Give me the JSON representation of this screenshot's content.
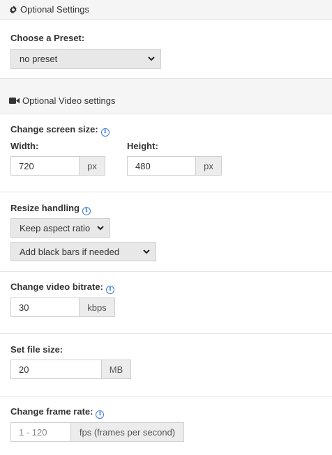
{
  "optional_settings": {
    "title": "Optional Settings",
    "preset_label": "Choose a Preset:",
    "preset_value": "no preset"
  },
  "video_settings": {
    "title": "Optional Video settings",
    "screen_size_label": "Change screen size:",
    "width_label": "Width:",
    "width_value": "720",
    "width_unit": "px",
    "height_label": "Height:",
    "height_value": "480",
    "height_unit": "px",
    "resize_label": "Resize handling",
    "resize_mode": "Keep aspect ratio",
    "resize_bars": "Add black bars if needed",
    "bitrate_label": "Change video bitrate:",
    "bitrate_value": "30",
    "bitrate_unit": "kbps",
    "filesize_label": "Set file size:",
    "filesize_value": "20",
    "filesize_unit": "MB",
    "framerate_label": "Change frame rate:",
    "framerate_placeholder": "1 - 120",
    "framerate_unit": "fps (frames per second)"
  },
  "icons": {
    "settings": "gear-icon",
    "video": "video-camera-icon",
    "info": "info-icon",
    "dropdown": "chevron-down-icon"
  },
  "colors": {
    "info_accent": "#3b7ad9",
    "header_bg": "#f5f5f5",
    "select_bg": "#e8e8e8",
    "addon_bg": "#ececec"
  }
}
